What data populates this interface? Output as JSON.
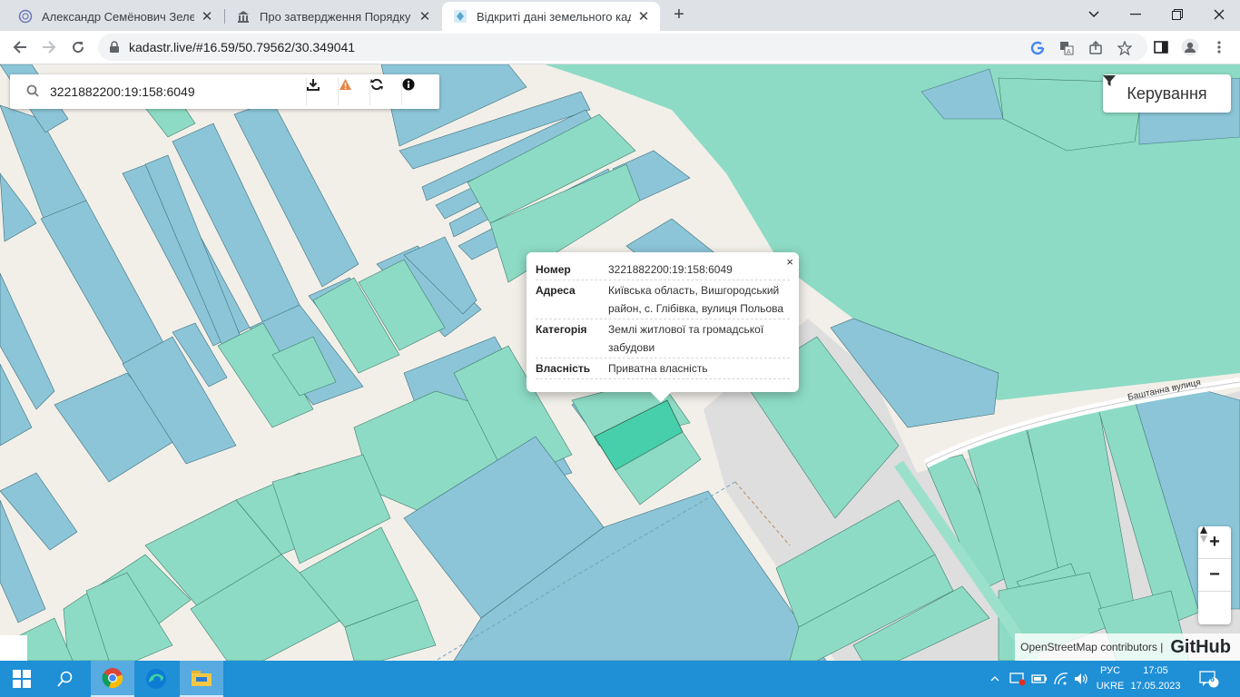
{
  "browser": {
    "tabs": [
      {
        "title": "Александр Семёнович Зеленский",
        "icon": "globe-icon",
        "active": false
      },
      {
        "title": "Про затвердження Порядку про",
        "icon": "government-building-icon",
        "active": false
      },
      {
        "title": "Відкриті дані земельного кадаст",
        "icon": "map-pin-icon",
        "active": true
      }
    ],
    "new_tab_label": "+",
    "url": "kadastr.live/#16.59/50.79562/30.349041"
  },
  "map": {
    "search_value": "3221882200:19:158:6049",
    "control_label": "Керування",
    "street_label": "Баштанна вулиця",
    "popup": {
      "close": "×",
      "rows": [
        {
          "key": "Номер",
          "value": "3221882200:19:158:6049"
        },
        {
          "key": "Адреса",
          "value": "Київська область, Вишгородський район, с. Глібівка, вулиця Польова"
        },
        {
          "key": "Категорія",
          "value": "Землі житлової та громадської забудови"
        },
        {
          "key": "Власність",
          "value": "Приватна власність"
        }
      ]
    },
    "zoom_in": "+",
    "zoom_out": "−",
    "attribution": "OpenStreetMap contributors |",
    "github_label": "GitHub",
    "colors": {
      "residential": "#8ddbc4",
      "agricultural": "#8bc5d7",
      "selected": "#47cfab",
      "road": "#f2efe9",
      "forest": "#8ddbc4"
    }
  },
  "taskbar": {
    "language": "РУС",
    "layout": "UKRE",
    "time": "17:05",
    "date": "17.05.2023",
    "notifications": "6"
  }
}
